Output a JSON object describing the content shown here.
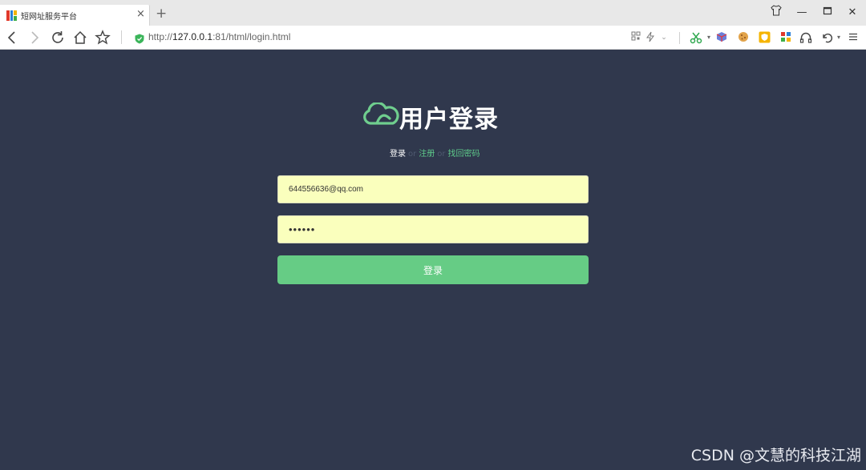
{
  "browser": {
    "tab_title": "短网址服务平台",
    "tab_close": "×",
    "new_tab": "+",
    "url_prefix": "http://",
    "url_host": "127.0.0.1",
    "url_rest": ":81/html/login.html",
    "window_controls": {
      "minimize": "—",
      "restore": "❐",
      "close": "✕",
      "skin": "shirt-icon"
    }
  },
  "login": {
    "title": "用户登录",
    "nav": {
      "login": "登录",
      "separator": "or",
      "register": "注册",
      "forgot": "找回密码"
    },
    "email_value": "644556636@qq.com",
    "password_value": "••••••",
    "submit_label": "登录"
  },
  "watermark": "CSDN @文慧的科技江湖",
  "colors": {
    "page_bg": "#30384d",
    "accent": "#66cc85",
    "input_bg": "#faffbd"
  }
}
